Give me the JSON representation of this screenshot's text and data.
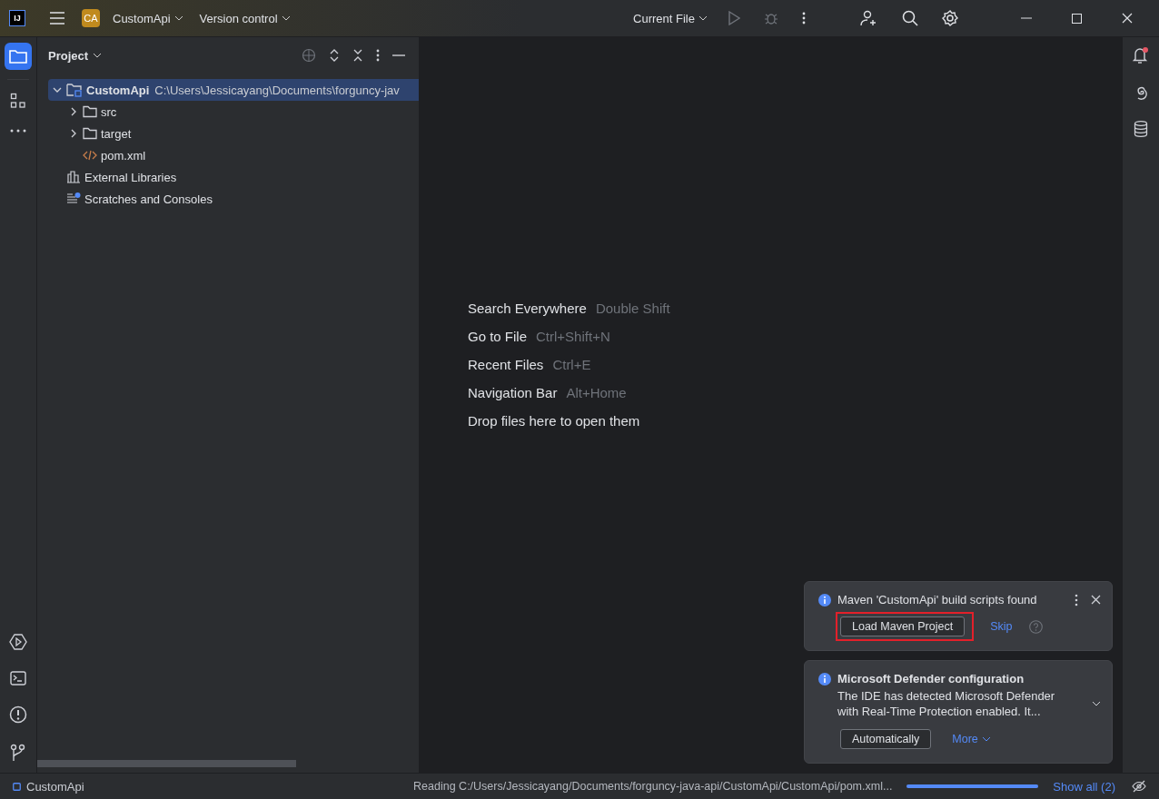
{
  "title_bar": {
    "logo": "IJ",
    "project_badge": "CA",
    "project": "CustomApi",
    "vcs": "Version control",
    "run_config": "Current File"
  },
  "project_panel": {
    "title": "Project",
    "tree": [
      {
        "label": "CustomApi",
        "path": "C:\\Users\\Jessicayang\\Documents\\forguncy-jav",
        "kind": "module",
        "expanded": true,
        "selected": true,
        "children": [
          {
            "label": "src",
            "kind": "folder",
            "expanded": false,
            "selected": false
          },
          {
            "label": "target",
            "kind": "folder",
            "expanded": false,
            "selected": false
          },
          {
            "label": "pom.xml",
            "kind": "xml",
            "selected": false
          }
        ]
      },
      {
        "label": "External Libraries",
        "kind": "libraries",
        "selected": false
      },
      {
        "label": "Scratches and Consoles",
        "kind": "scratches",
        "selected": false
      }
    ]
  },
  "editor_hints": [
    {
      "action": "Search Everywhere",
      "shortcut": "Double Shift"
    },
    {
      "action": "Go to File",
      "shortcut": "Ctrl+Shift+N"
    },
    {
      "action": "Recent Files",
      "shortcut": "Ctrl+E"
    },
    {
      "action": "Navigation Bar",
      "shortcut": "Alt+Home"
    },
    {
      "action": "Drop files here to open them"
    }
  ],
  "notifications": [
    {
      "title": "Maven 'CustomApi' build scripts found",
      "button": "Load Maven Project",
      "highlighted": true,
      "link": "Skip",
      "help": true,
      "closable": true
    },
    {
      "title": "Microsoft Defender configuration",
      "bold_title": true,
      "body": "The IDE has detected Microsoft Defender with Real-Time Protection enabled. It...",
      "button": "Automatically",
      "link": "More",
      "link_menu": true,
      "expandable": true
    }
  ],
  "status_bar": {
    "project": "CustomApi",
    "progress_text": "Reading C:/Users/Jessicayang/Documents/forguncy-java-api/CustomApi/CustomApi/pom.xml...",
    "level": 1,
    "show_all": "Show all (2)"
  }
}
